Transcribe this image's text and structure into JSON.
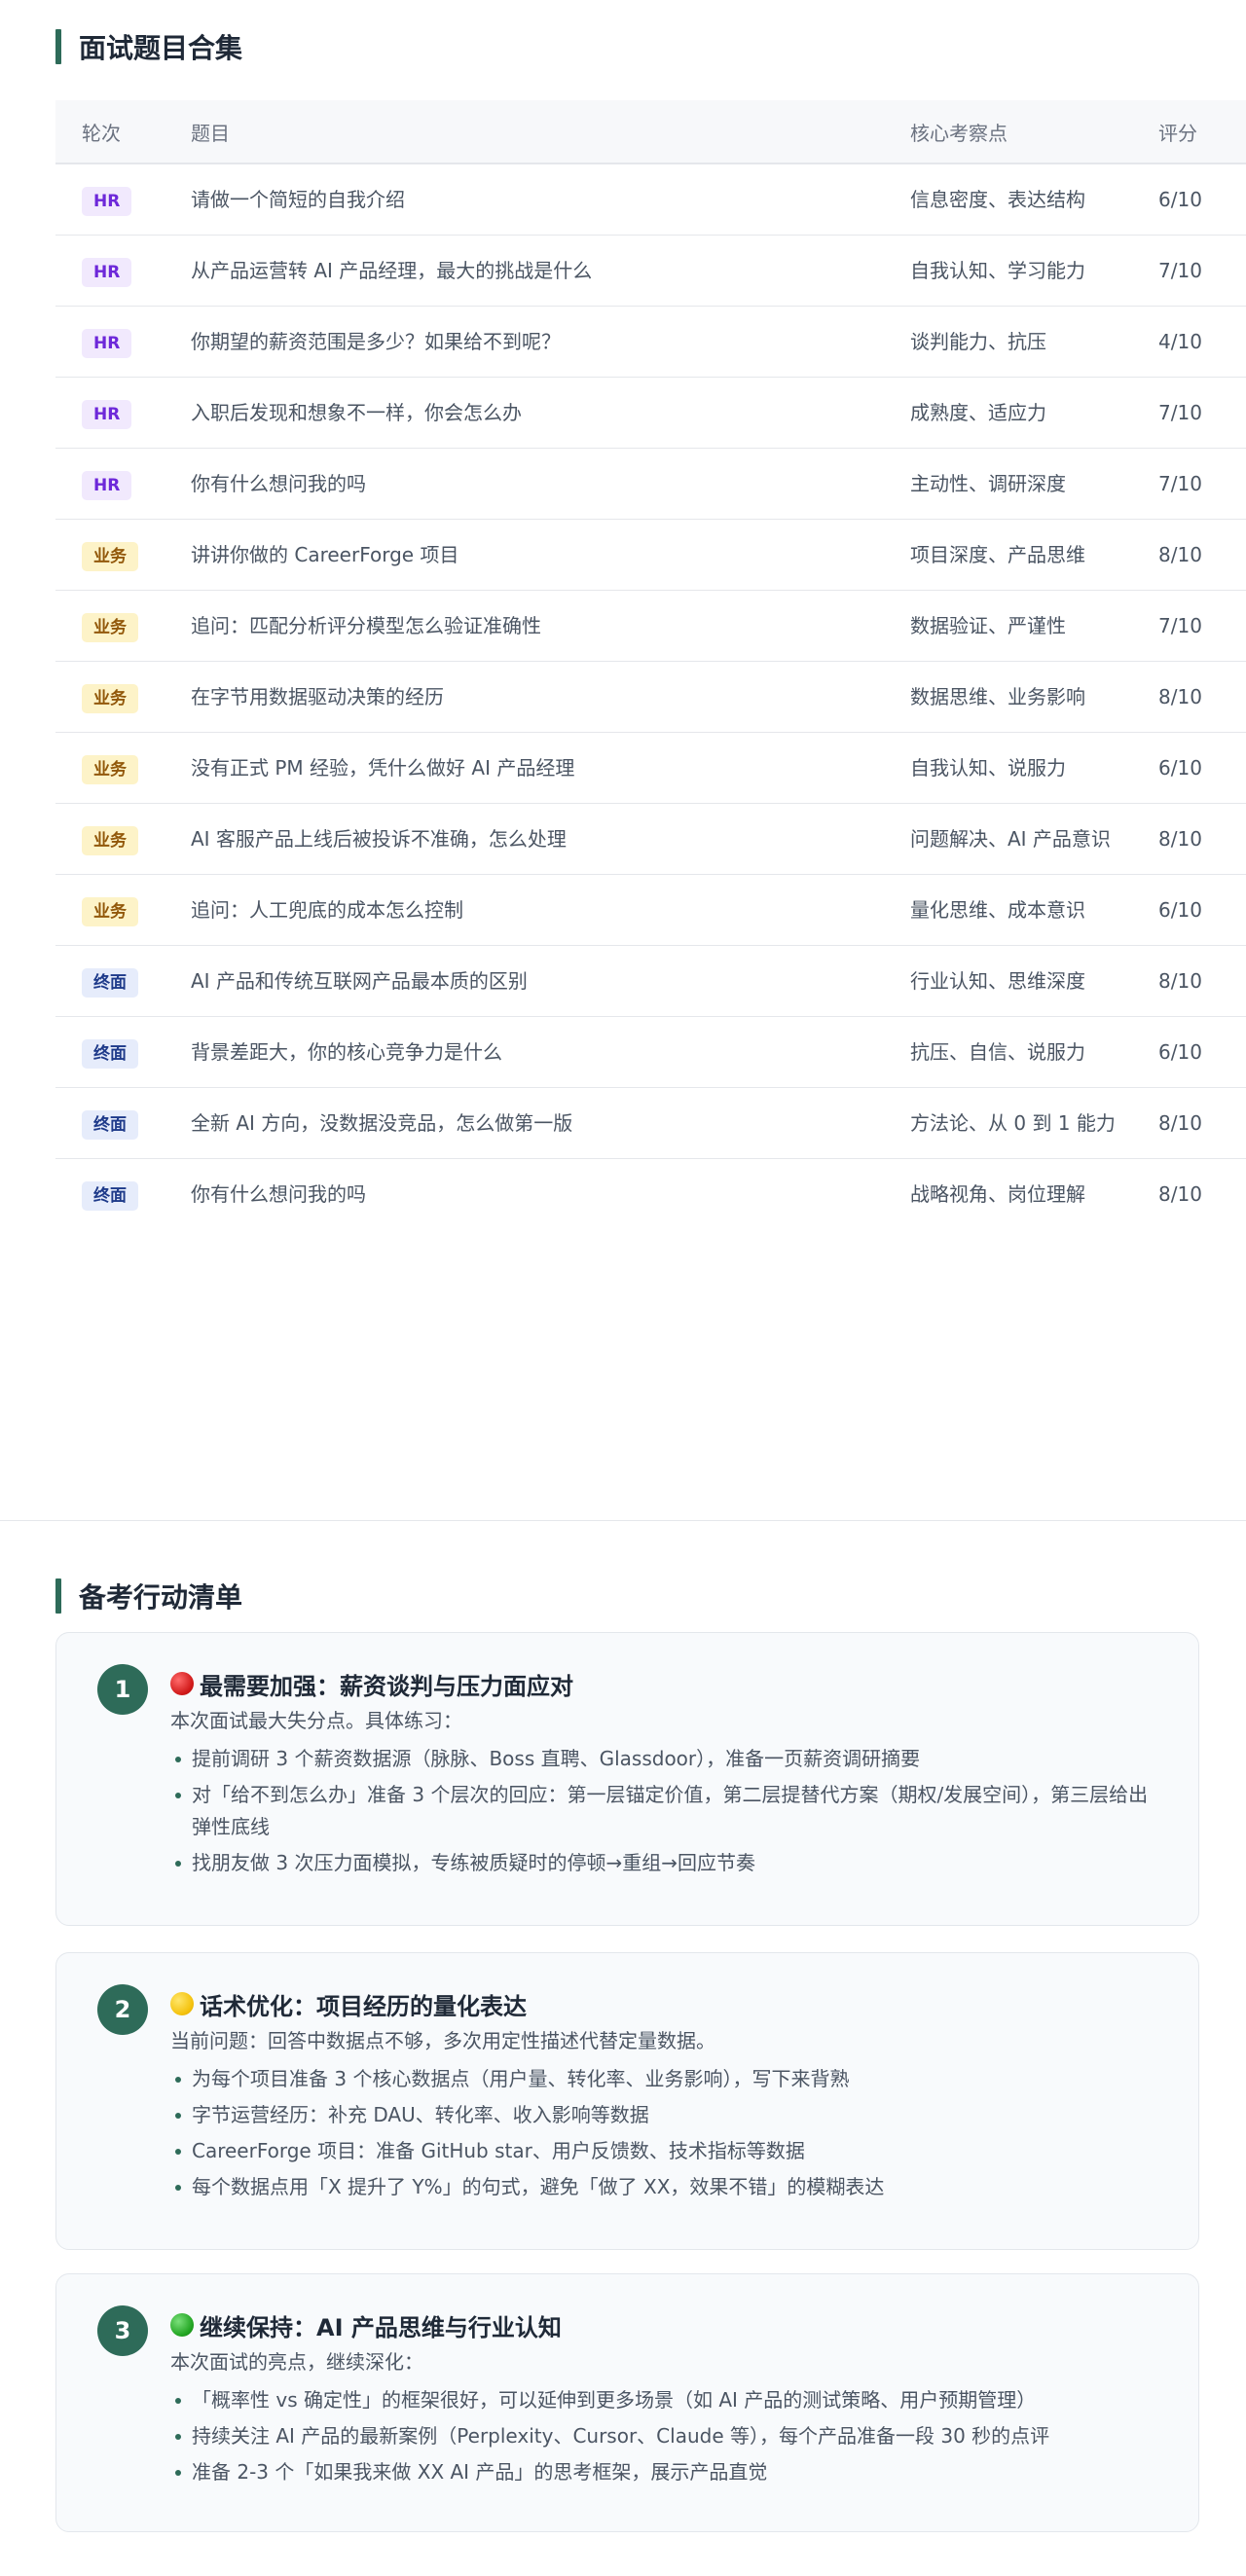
{
  "questions_section": {
    "title": "面试题目合集",
    "headers": {
      "round": "轮次",
      "question": "题目",
      "focus": "核心考察点",
      "score": "评分"
    },
    "rows": [
      {
        "round": "HR",
        "type": "hr",
        "question": "请做一个简短的自我介绍",
        "focus": "信息密度、表达结构",
        "score": "6/10"
      },
      {
        "round": "HR",
        "type": "hr",
        "question": "从产品运营转 AI 产品经理，最大的挑战是什么",
        "focus": "自我认知、学习能力",
        "score": "7/10"
      },
      {
        "round": "HR",
        "type": "hr",
        "question": "你期望的薪资范围是多少？如果给不到呢？",
        "focus": "谈判能力、抗压",
        "score": "4/10"
      },
      {
        "round": "HR",
        "type": "hr",
        "question": "入职后发现和想象不一样，你会怎么办",
        "focus": "成熟度、适应力",
        "score": "7/10"
      },
      {
        "round": "HR",
        "type": "hr",
        "question": "你有什么想问我的吗",
        "focus": "主动性、调研深度",
        "score": "7/10"
      },
      {
        "round": "业务",
        "type": "biz",
        "question": "讲讲你做的 CareerForge 项目",
        "focus": "项目深度、产品思维",
        "score": "8/10"
      },
      {
        "round": "业务",
        "type": "biz",
        "question": "追问：匹配分析评分模型怎么验证准确性",
        "focus": "数据验证、严谨性",
        "score": "7/10"
      },
      {
        "round": "业务",
        "type": "biz",
        "question": "在字节用数据驱动决策的经历",
        "focus": "数据思维、业务影响",
        "score": "8/10"
      },
      {
        "round": "业务",
        "type": "biz",
        "question": "没有正式 PM 经验，凭什么做好 AI 产品经理",
        "focus": "自我认知、说服力",
        "score": "6/10"
      },
      {
        "round": "业务",
        "type": "biz",
        "question": "AI 客服产品上线后被投诉不准确，怎么处理",
        "focus": "问题解决、AI 产品意识",
        "score": "8/10"
      },
      {
        "round": "业务",
        "type": "biz",
        "question": "追问：人工兜底的成本怎么控制",
        "focus": "量化思维、成本意识",
        "score": "6/10"
      },
      {
        "round": "终面",
        "type": "final",
        "question": "AI 产品和传统互联网产品最本质的区别",
        "focus": "行业认知、思维深度",
        "score": "8/10"
      },
      {
        "round": "终面",
        "type": "final",
        "question": "背景差距大，你的核心竞争力是什么",
        "focus": "抗压、自信、说服力",
        "score": "6/10"
      },
      {
        "round": "终面",
        "type": "final",
        "question": "全新 AI 方向，没数据没竞品，怎么做第一版",
        "focus": "方法论、从 0 到 1 能力",
        "score": "8/10"
      },
      {
        "round": "终面",
        "type": "final",
        "question": "你有什么想问我的吗",
        "focus": "战略视角、岗位理解",
        "score": "8/10"
      }
    ]
  },
  "action_section": {
    "title": "备考行动清单",
    "cards": [
      {
        "number": "1",
        "dot": "red-circle-icon",
        "title": "最需要加强：薪资谈判与压力面应对",
        "intro": "本次面试最大失分点。具体练习：",
        "items": [
          "提前调研 3 个薪资数据源（脉脉、Boss 直聘、Glassdoor），准备一页薪资调研摘要",
          "对「给不到怎么办」准备 3 个层次的回应：第一层锚定价值，第二层提替代方案（期权/发展空间），第三层给出弹性底线",
          "找朋友做 3 次压力面模拟，专练被质疑时的停顿→重组→回应节奏"
        ]
      },
      {
        "number": "2",
        "dot": "yellow-circle-icon",
        "title": "话术优化：项目经历的量化表达",
        "intro": "当前问题：回答中数据点不够，多次用定性描述代替定量数据。",
        "items": [
          "为每个项目准备 3 个核心数据点（用户量、转化率、业务影响），写下来背熟",
          "字节运营经历：补充 DAU、转化率、收入影响等数据",
          "CareerForge 项目：准备 GitHub star、用户反馈数、技术指标等数据",
          "每个数据点用「X 提升了 Y%」的句式，避免「做了 XX，效果不错」的模糊表达"
        ]
      },
      {
        "number": "3",
        "dot": "green-circle-icon",
        "title": "继续保持：AI 产品思维与行业认知",
        "intro": "本次面试的亮点，继续深化：",
        "items": [
          "「概率性 vs 确定性」的框架很好，可以延伸到更多场景（如 AI 产品的测试策略、用户预期管理）",
          "持续关注 AI 产品的最新案例（Perplexity、Cursor、Claude 等），每个产品准备一段 30 秒的点评",
          "准备 2-3 个「如果我来做 XX AI 产品」的思考框架，展示产品直觉"
        ]
      }
    ]
  }
}
